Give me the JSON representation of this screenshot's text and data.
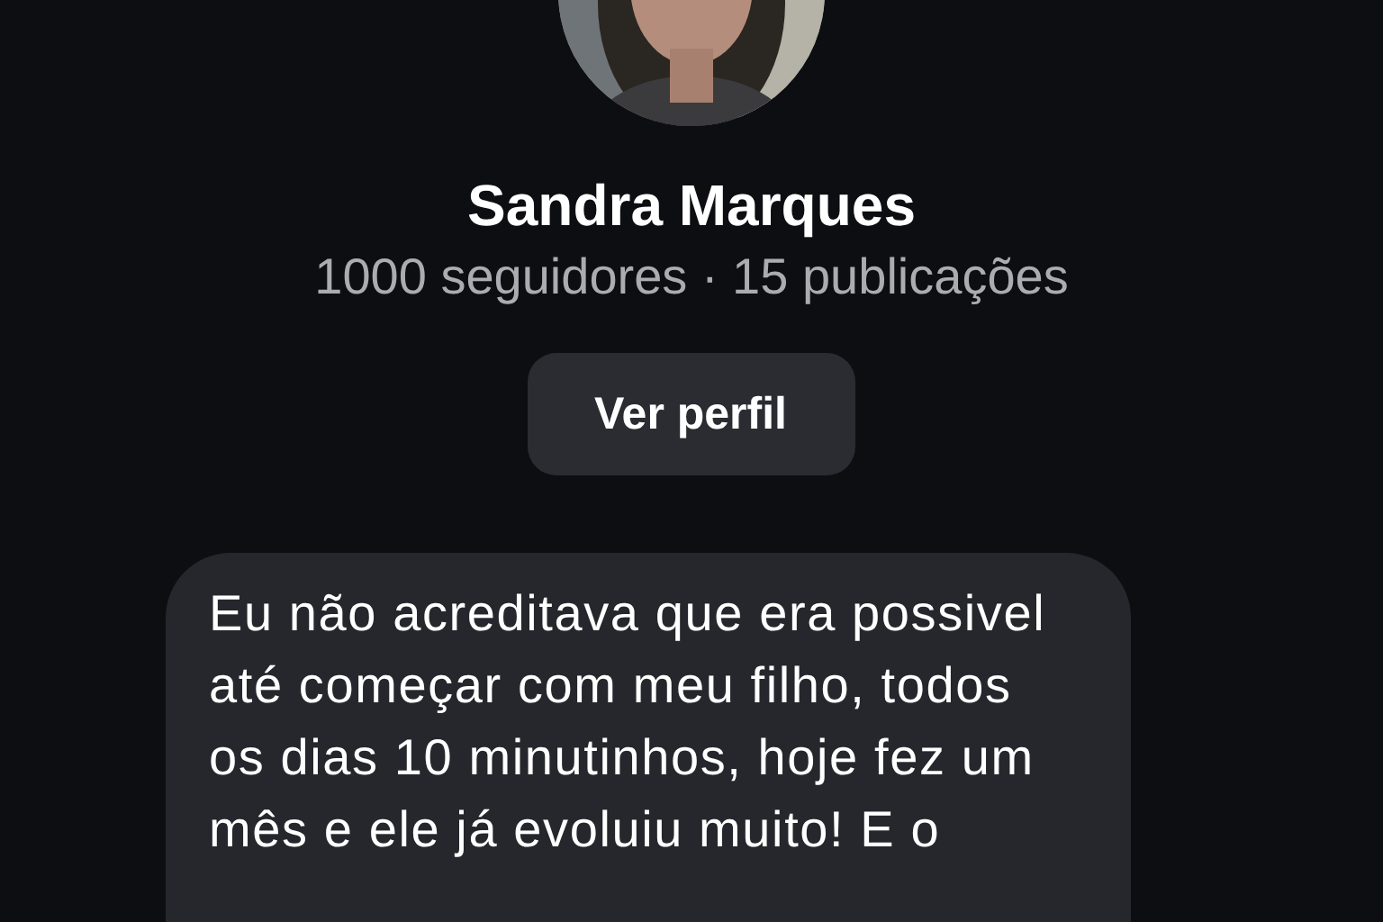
{
  "profile": {
    "name": "Sandra Marques",
    "stats": "1000 seguidores · 15 publicações",
    "button": "Ver perfil"
  },
  "messages": [
    {
      "text": "Eu não acreditava que era possivel até começar com meu filho, todos os dias 10 minutinhos, hoje fez um mês e ele já evoluiu muito! E o"
    }
  ]
}
